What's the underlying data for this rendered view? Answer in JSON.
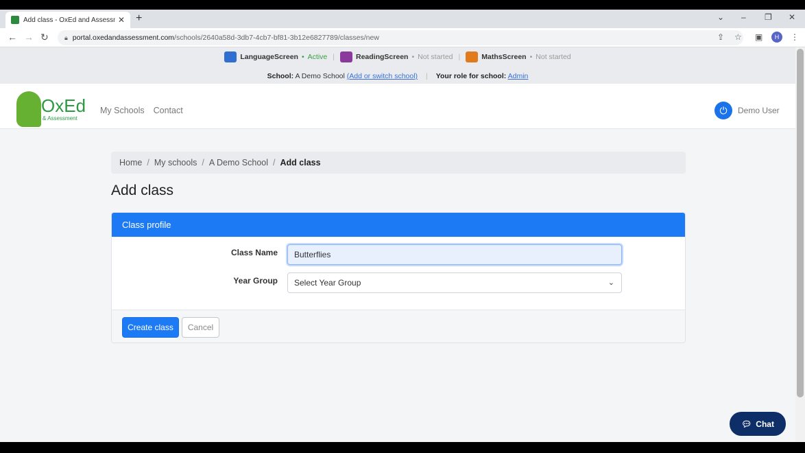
{
  "browser": {
    "tab_title": "Add class - OxEd and Assessment",
    "tab_close": "✕",
    "new_tab": "+",
    "url_host": "portal.oxedandassessment.com",
    "url_path": "/schools/2640a58d-3db7-4cb7-bf81-3b12e6827789/classes/new",
    "profile_initial": "H",
    "window_controls": [
      "⌄",
      "–",
      "❐",
      "✕"
    ]
  },
  "screens": [
    {
      "name": "LanguageScreen",
      "status": "Active",
      "status_type": "active",
      "color": "#2f6fd0"
    },
    {
      "name": "ReadingScreen",
      "status": "Not started",
      "status_type": "not",
      "color": "#8a3a9c"
    },
    {
      "name": "MathsScreen",
      "status": "Not started",
      "status_type": "not",
      "color": "#e07a1a"
    }
  ],
  "school_bar": {
    "school_label": "School:",
    "school_name": "A Demo School",
    "switch_link": "(Add or switch school)",
    "role_label": "Your role for school:",
    "role": "Admin"
  },
  "header": {
    "logo_text": "OxEd",
    "logo_sub": "& Assessment",
    "nav": [
      "My Schools",
      "Contact"
    ],
    "user_name": "Demo User"
  },
  "breadcrumb": [
    "Home",
    "My schools",
    "A Demo School",
    "Add class"
  ],
  "page_title": "Add class",
  "card": {
    "header": "Class profile",
    "class_name_label": "Class Name",
    "class_name_value": "Butterflies",
    "year_group_label": "Year Group",
    "year_group_value": "Select Year Group",
    "create_label": "Create class",
    "cancel_label": "Cancel"
  },
  "chat_label": "Chat",
  "colors": {
    "primary": "#1d7af5",
    "chat": "#0d2e66",
    "brand": "#2c9a43"
  }
}
